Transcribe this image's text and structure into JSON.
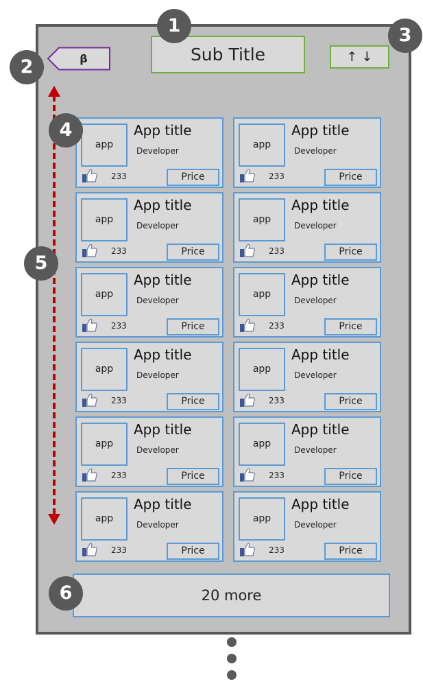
{
  "header": {
    "subtitle": "Sub Title",
    "sort_label": "↑ ↓",
    "back_label": "β"
  },
  "badges": [
    "1",
    "2",
    "3",
    "4",
    "5",
    "6"
  ],
  "cards": [
    {
      "thumb": "app",
      "title": "App title",
      "developer": "Developer",
      "likes": "233",
      "price": "Price"
    },
    {
      "thumb": "app",
      "title": "App title",
      "developer": "Developer",
      "likes": "233",
      "price": "Price"
    },
    {
      "thumb": "app",
      "title": "App title",
      "developer": "Developer",
      "likes": "233",
      "price": "Price"
    },
    {
      "thumb": "app",
      "title": "App title",
      "developer": "Developer",
      "likes": "233",
      "price": "Price"
    },
    {
      "thumb": "app",
      "title": "App title",
      "developer": "Developer",
      "likes": "233",
      "price": "Price"
    },
    {
      "thumb": "app",
      "title": "App title",
      "developer": "Developer",
      "likes": "233",
      "price": "Price"
    },
    {
      "thumb": "app",
      "title": "App title",
      "developer": "Developer",
      "likes": "233",
      "price": "Price"
    },
    {
      "thumb": "app",
      "title": "App title",
      "developer": "Developer",
      "likes": "233",
      "price": "Price"
    },
    {
      "thumb": "app",
      "title": "App title",
      "developer": "Developer",
      "likes": "233",
      "price": "Price"
    },
    {
      "thumb": "app",
      "title": "App title",
      "developer": "Developer",
      "likes": "233",
      "price": "Price"
    },
    {
      "thumb": "app",
      "title": "App title",
      "developer": "Developer",
      "likes": "233",
      "price": "Price"
    },
    {
      "thumb": "app",
      "title": "App title",
      "developer": "Developer",
      "likes": "233",
      "price": "Price"
    }
  ],
  "more": {
    "label": "20 more"
  },
  "icons": {
    "like": "thumbs-up-icon",
    "scroll": "scroll-arrow-icon"
  },
  "colors": {
    "frame_bg": "#bfbfbf",
    "frame_border": "#595959",
    "card_border": "#5b9bd5",
    "header_border": "#70ad47",
    "back_border": "#7030a0",
    "scroll_arrow": "#c00000",
    "badge_bg": "#595959"
  }
}
